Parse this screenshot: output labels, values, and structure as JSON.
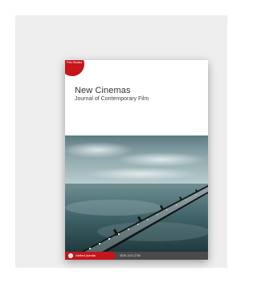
{
  "cover": {
    "badge": "Film Studies",
    "title": "New Cinemas",
    "subtitle": "Journal of Contemporary Film",
    "publisher": "intellect journals",
    "issn": "ISSN 1474-2756"
  }
}
